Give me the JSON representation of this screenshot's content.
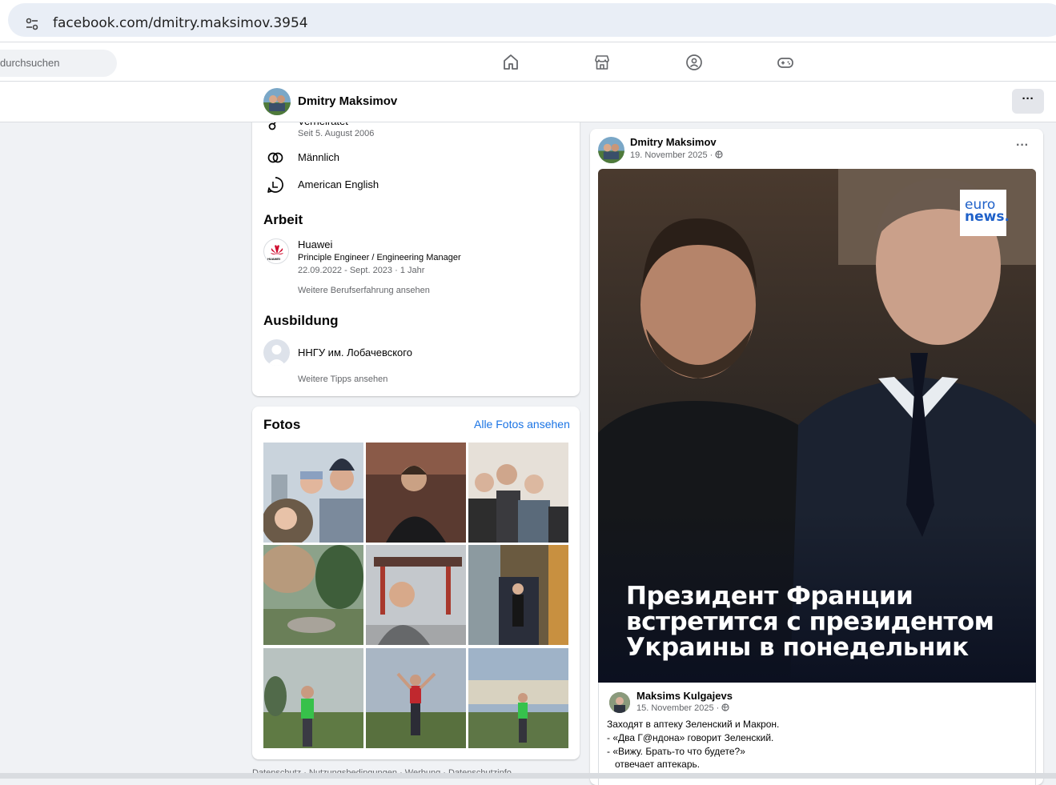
{
  "browser": {
    "url": "facebook.com/dmitry.maksimov.3954"
  },
  "fbnav": {
    "search_placeholder": "durchsuchen",
    "icons": [
      "home-icon",
      "marketplace-icon",
      "groups-icon",
      "gaming-icon"
    ]
  },
  "profile_header": {
    "name": "Dmitry Maksimov",
    "more_label": "···"
  },
  "intro": {
    "relationship_partial": "Verheiratet",
    "relationship_since": "Seit 5. August 2006",
    "gender": "Männlich",
    "language": "American English",
    "work_title": "Arbeit",
    "work": {
      "company": "Huawei",
      "role": "Principle Engineer / Engineering Manager",
      "period": "22.09.2022 - Sept. 2023 · 1 Jahr",
      "more": "Weitere Berufserfahrung ansehen",
      "logo_text": "HUAWEI"
    },
    "education_title": "Ausbildung",
    "education": {
      "school": "ННГУ им. Лобачевского",
      "more": "Weitere Tipps ansehen"
    }
  },
  "photos": {
    "title": "Fotos",
    "see_all": "Alle Fotos ansehen",
    "count": 9
  },
  "post": {
    "author": "Dmitry Maksimov",
    "date": "19. November 2025 · ",
    "more_label": "···",
    "image_logo": [
      "euro",
      "news."
    ],
    "caption_lines": [
      "Президент Франции",
      "встретится с президентом",
      "Украины в понедельник"
    ],
    "shared": {
      "author": "Maksims Kulgajevs",
      "date": "15. November 2025 · ",
      "text_lines": [
        "Заходят в аптеку Зеленский и Макрон.",
        "- «Два Г@ндона» говорит Зеленский.",
        "- «Вижу. Брать-то что будете?»",
        "   отвечает аптекарь."
      ]
    }
  },
  "footer": {
    "text": "Datenschutz · Nutzungsbedingungen · Werbung · Datenschutzinfo"
  }
}
